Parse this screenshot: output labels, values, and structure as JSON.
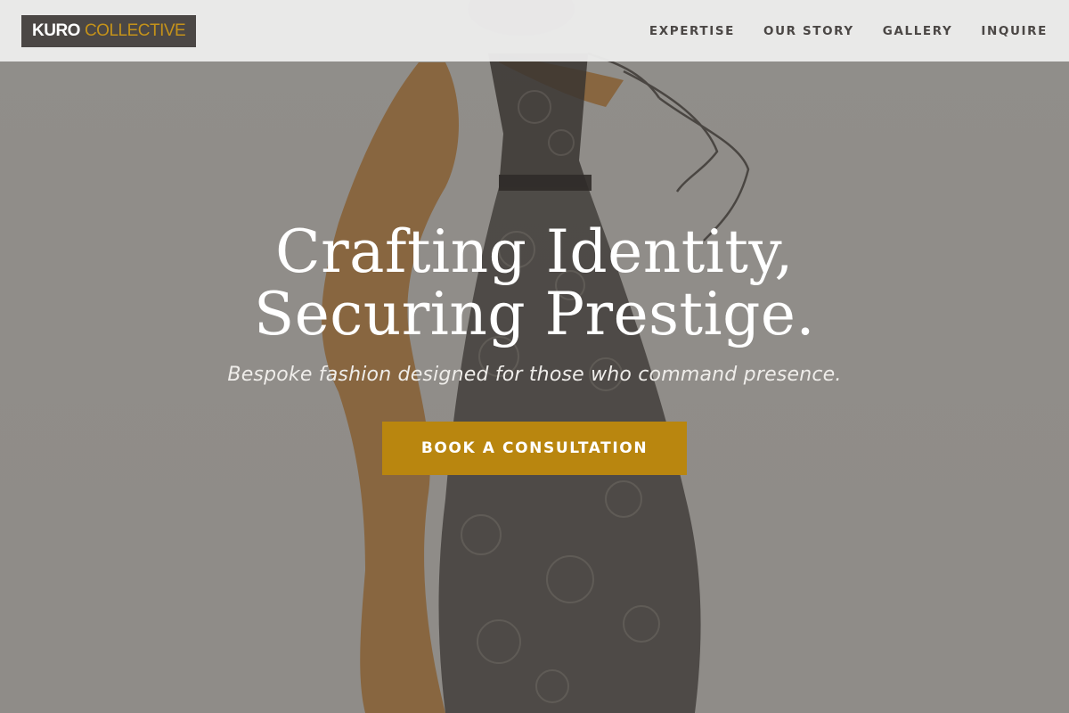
{
  "header": {
    "logo_primary": "KURO",
    "logo_secondary": "COLLECTIVE",
    "nav": [
      {
        "label": "EXPERTISE"
      },
      {
        "label": "OUR STORY"
      },
      {
        "label": "GALLERY"
      },
      {
        "label": "INQUIRE"
      }
    ]
  },
  "hero": {
    "headline_line1": "Crafting Identity,",
    "headline_line2": "Securing Prestige.",
    "subline": "Bespoke fashion designed for those who command presence.",
    "cta_label": "BOOK A CONSULTATION",
    "background_image": "fashion-sketch-illustration"
  },
  "colors": {
    "accent": "#b9860f",
    "logo_bg": "#4b4745",
    "header_bg": "#ececec",
    "overlay": "#46423e"
  }
}
